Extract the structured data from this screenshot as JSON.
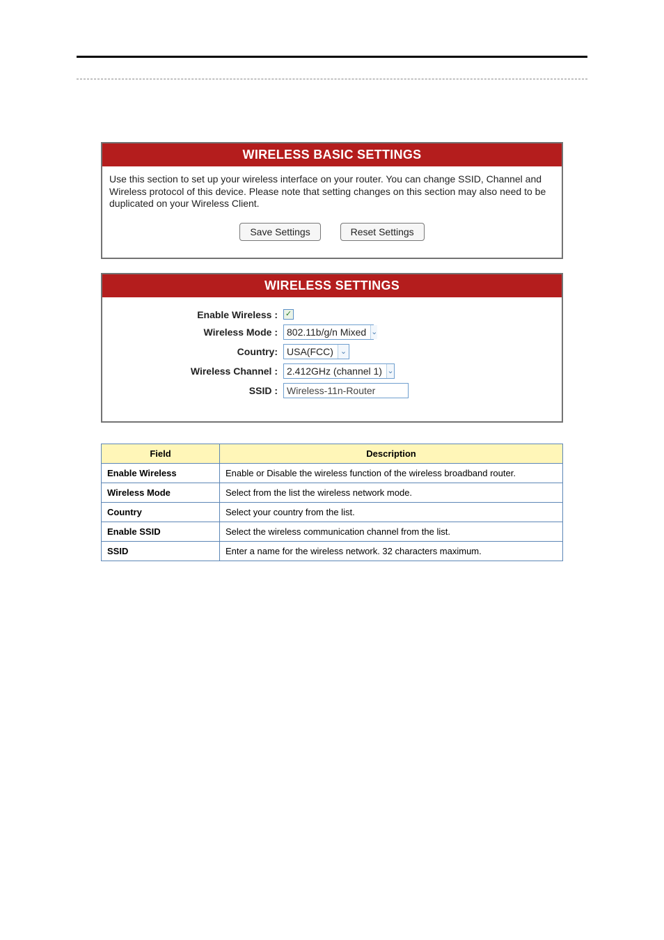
{
  "panel1": {
    "title": "WIRELESS BASIC SETTINGS",
    "description": "Use this section to set up your wireless interface on your router. You can change SSID, Channel and Wireless protocol of this device. Please note that setting changes on this section may also need to be duplicated on your Wireless Client.",
    "buttons": {
      "save": "Save Settings",
      "reset": "Reset Settings"
    }
  },
  "panel2": {
    "title": "WIRELESS SETTINGS",
    "rows": {
      "enable_wireless": {
        "label": "Enable Wireless :",
        "checked": true
      },
      "wireless_mode": {
        "label": "Wireless Mode :",
        "value": "802.11b/g/n Mixed"
      },
      "country": {
        "label": "Country:",
        "value": "USA(FCC)"
      },
      "wireless_channel": {
        "label": "Wireless Channel :",
        "value": "2.412GHz (channel 1)"
      },
      "ssid": {
        "label": "SSID :",
        "value": "Wireless-11n-Router"
      }
    }
  },
  "info_table": {
    "header": {
      "field": "Field",
      "description": "Description"
    },
    "rows": [
      {
        "label": "Enable Wireless",
        "desc": "Enable or Disable the wireless function of the wireless broadband router."
      },
      {
        "label": "Wireless Mode",
        "desc": "Select from the list the wireless network mode."
      },
      {
        "label": "Country",
        "desc": "Select your country from the list."
      },
      {
        "label": "Enable SSID",
        "desc": "Select the wireless communication channel from the list."
      },
      {
        "label": "SSID",
        "desc": "Enter a name for the wireless network. 32 characters maximum."
      }
    ]
  }
}
